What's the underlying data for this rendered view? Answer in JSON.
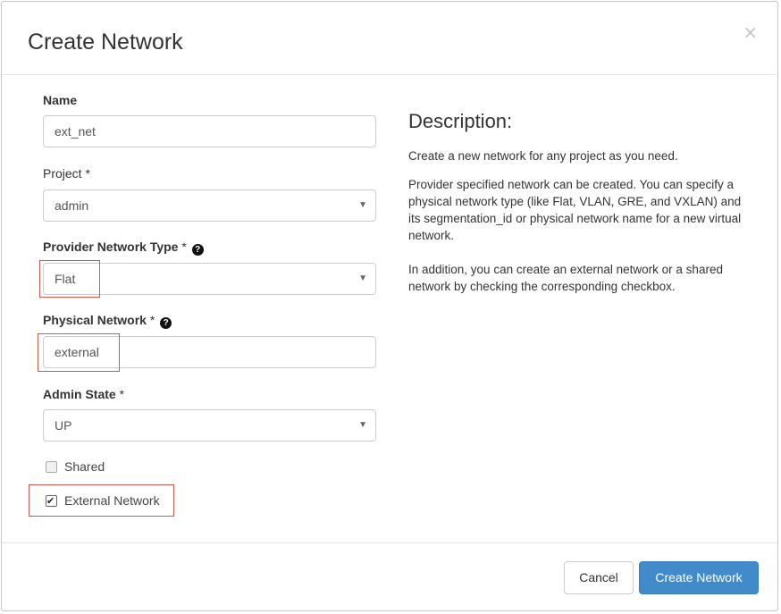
{
  "modal": {
    "title": "Create Network",
    "close_symbol": "×"
  },
  "form": {
    "name": {
      "label": "Name",
      "value": "ext_net"
    },
    "project": {
      "label": "Project",
      "required_mark": "*",
      "selected": "admin"
    },
    "provider_network_type": {
      "label": "Provider Network Type",
      "required_mark": "*",
      "help_icon": "?",
      "selected": "Flat"
    },
    "physical_network": {
      "label": "Physical Network",
      "required_mark": "*",
      "help_icon": "?",
      "value": "external"
    },
    "admin_state": {
      "label": "Admin State",
      "required_mark": "*",
      "selected": "UP"
    },
    "shared": {
      "label": "Shared",
      "checked": false
    },
    "external_network": {
      "label": "External Network",
      "checked": true
    }
  },
  "description": {
    "title": "Description:",
    "paragraphs": [
      "Create a new network for any project as you need.",
      "Provider specified network can be created. You can specify a physical network type (like Flat, VLAN, GRE, and VXLAN) and its segmentation_id or physical network name for a new virtual network.",
      "In addition, you can create an external network or a shared network by checking the corresponding checkbox."
    ]
  },
  "footer": {
    "cancel_label": "Cancel",
    "submit_label": "Create Network"
  },
  "icons": {
    "help": "question-circle-icon",
    "caret": "caret-down-icon",
    "close": "close-icon",
    "check": "check-icon"
  },
  "colors": {
    "primary": "#428bca",
    "highlight": "#d9534f",
    "border": "#cccccc"
  }
}
